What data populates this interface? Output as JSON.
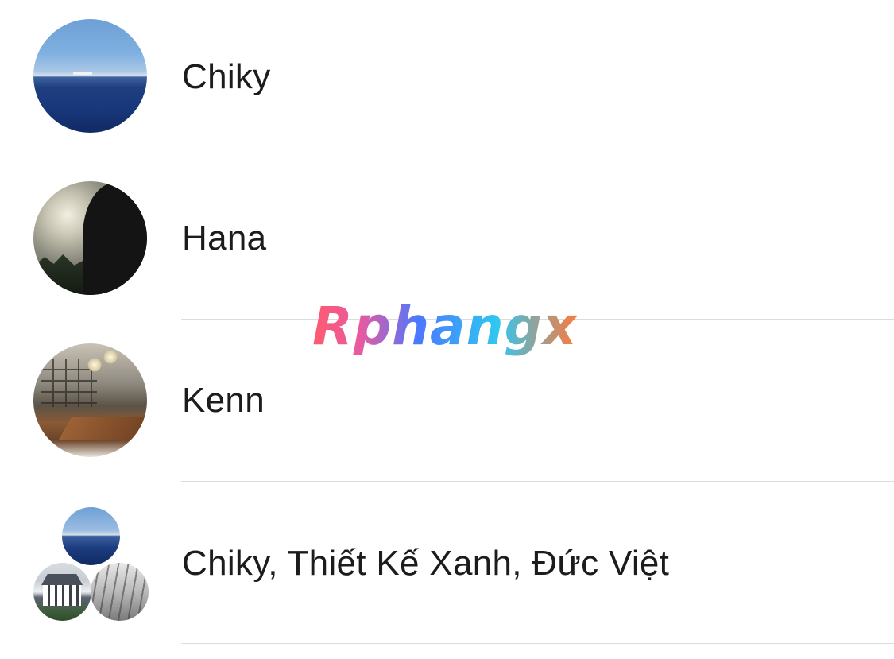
{
  "conversations": [
    {
      "name": "Chiky",
      "avatar": "ocean-photo"
    },
    {
      "name": "Hana",
      "avatar": "silhouette-sunset-photo"
    },
    {
      "name": "Kenn",
      "avatar": "interior-room-photo"
    },
    {
      "name": "Chiky, Thiết Kế Xanh, Đức Việt",
      "avatar": "group-avatar"
    }
  ],
  "watermark": "Rphangx",
  "colors": {
    "text": "#1c1c1c",
    "divider": "#dcdcdc",
    "background": "#ffffff"
  }
}
